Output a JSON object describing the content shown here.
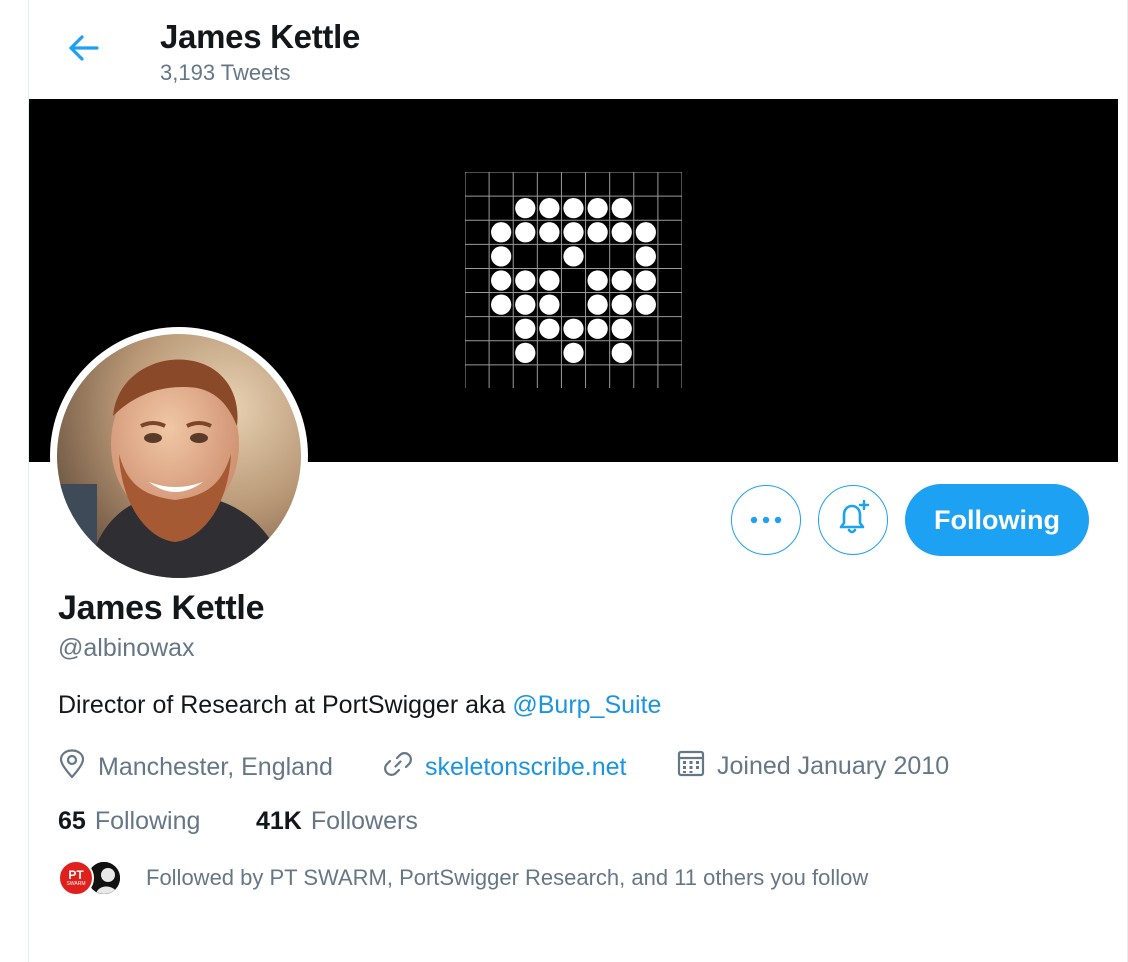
{
  "header": {
    "name": "James Kettle",
    "tweet_count": "3,193 Tweets"
  },
  "profile": {
    "name": "James Kettle",
    "handle": "@albinowax",
    "bio_text": "Director of Research at PortSwigger aka ",
    "bio_mention": "@Burp_Suite",
    "location": "Manchester, England",
    "website": "skeletonscribe.net",
    "joined": "Joined January 2010"
  },
  "stats": {
    "following_count": "65",
    "following_label": "Following",
    "followers_count": "41K",
    "followers_label": "Followers"
  },
  "actions": {
    "follow_label": "Following"
  },
  "followed_by": {
    "text": "Followed by PT SWARM, PortSwigger Research, and 11 others you follow",
    "avatar1_text": "PT",
    "avatar1_subtext": "SWARM"
  },
  "icons": {
    "back": "arrow-left-icon",
    "more": "more-horizontal-icon",
    "notify": "bell-plus-icon",
    "location": "location-pin-icon",
    "website": "link-icon",
    "joined": "calendar-icon"
  },
  "colors": {
    "accent": "#1da1f2",
    "link": "#1b95e0",
    "muted": "#657786",
    "text": "#14171a",
    "banner": "#000000"
  }
}
